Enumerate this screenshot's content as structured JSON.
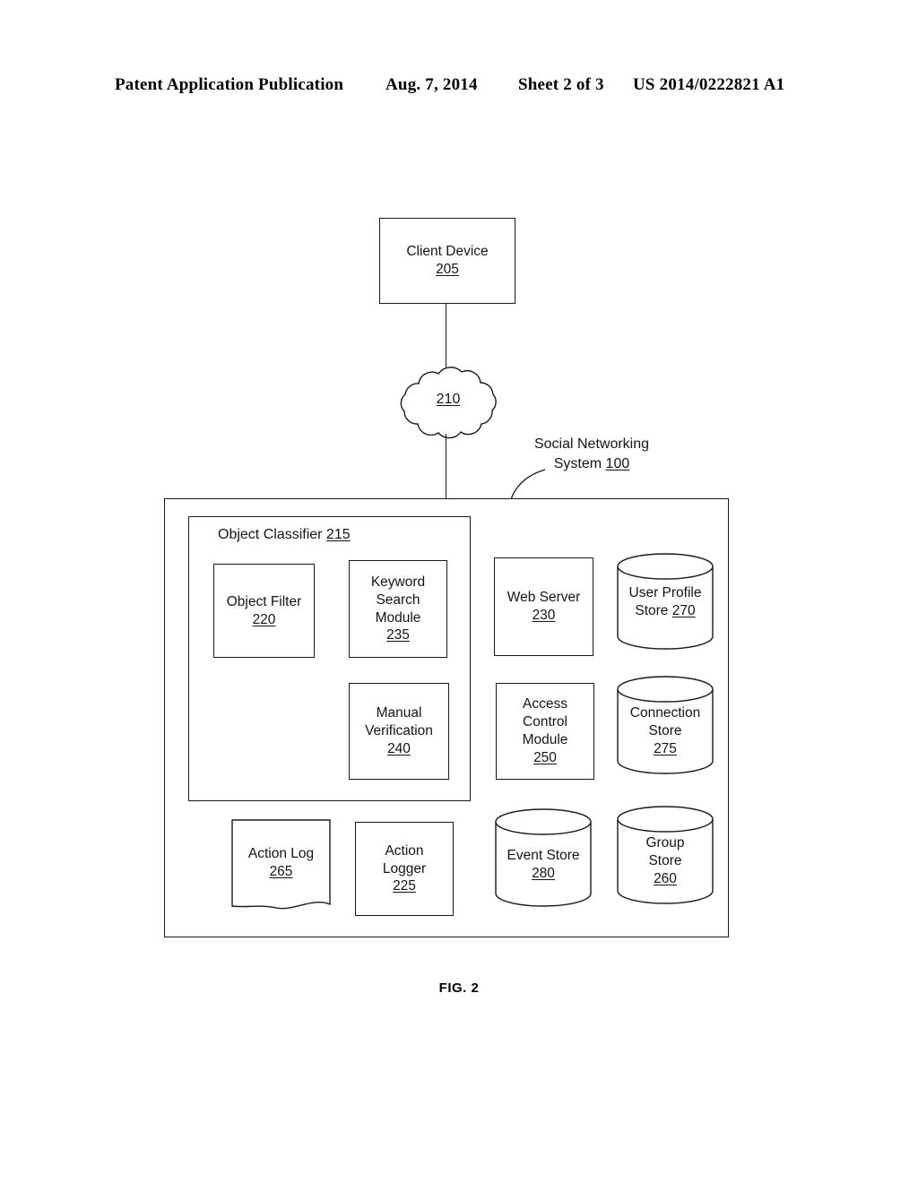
{
  "header": {
    "left": "Patent Application Publication",
    "date": "Aug. 7, 2014",
    "sheet": "Sheet 2 of 3",
    "publication_number": "US 2014/0222821 A1"
  },
  "figure": {
    "caption": "FIG. 2"
  },
  "diagram": {
    "client_device": {
      "title": "Client Device",
      "ref": "205"
    },
    "network_cloud": {
      "ref": "210"
    },
    "system_callout": {
      "line1": "Social Networking",
      "line2_text": "System ",
      "ref": "100"
    },
    "object_classifier": {
      "title": "Object Classifier ",
      "ref": "215"
    },
    "object_filter": {
      "title": "Object Filter",
      "ref": "220"
    },
    "keyword_search_module": {
      "line1": "Keyword",
      "line2": "Search",
      "line3": "Module",
      "ref": "235"
    },
    "manual_verification": {
      "line1": "Manual",
      "line2": "Verification",
      "ref": "240"
    },
    "web_server": {
      "title": "Web Server",
      "ref": "230"
    },
    "access_control_module": {
      "line1": "Access",
      "line2": "Control",
      "line3": "Module",
      "ref": "250"
    },
    "user_profile_store": {
      "line1": "User Profile",
      "line2_text": "Store ",
      "ref": "270"
    },
    "connection_store": {
      "line1": "Connection",
      "line2": "Store",
      "ref": "275"
    },
    "action_log": {
      "title": "Action Log",
      "ref": "265"
    },
    "action_logger": {
      "line1": "Action",
      "line2": "Logger",
      "ref": "225"
    },
    "event_store": {
      "title": "Event Store",
      "ref": "280"
    },
    "group_store": {
      "line1": "Group",
      "line2": "Store",
      "ref": "260"
    }
  },
  "colors": {
    "ink": "#1a1a1a",
    "paper": "#ffffff"
  }
}
